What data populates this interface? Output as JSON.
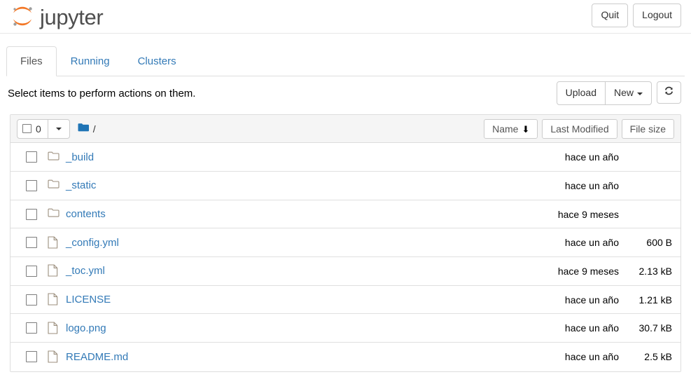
{
  "brand": {
    "name": "jupyter",
    "logo_icon": "jupyter-logo",
    "logo_color": "#f37726"
  },
  "header": {
    "quit_label": "Quit",
    "logout_label": "Logout"
  },
  "tabs": [
    {
      "label": "Files",
      "active": true
    },
    {
      "label": "Running",
      "active": false
    },
    {
      "label": "Clusters",
      "active": false
    }
  ],
  "actionbar": {
    "note": "Select items to perform actions on them.",
    "upload_label": "Upload",
    "new_label": "New",
    "new_caret_icon": "caret-down-icon",
    "refresh_icon": "refresh-icon"
  },
  "filelist": {
    "select_all_count": "0",
    "select_all_checkbox_icon": "checkbox-unchecked-icon",
    "select_caret_icon": "caret-down-icon",
    "breadcrumb_folder_icon": "folder-filled-icon",
    "breadcrumb_path": "/",
    "columns": {
      "name": "Name",
      "name_sort_icon": "arrow-down-icon",
      "last_modified": "Last Modified",
      "file_size": "File size"
    },
    "rows": [
      {
        "icon": "folder-icon",
        "name": "_build",
        "modified": "hace un año",
        "size": ""
      },
      {
        "icon": "folder-icon",
        "name": "_static",
        "modified": "hace un año",
        "size": ""
      },
      {
        "icon": "folder-icon",
        "name": "contents",
        "modified": "hace 9 meses",
        "size": ""
      },
      {
        "icon": "file-icon",
        "name": "_config.yml",
        "modified": "hace un año",
        "size": "600 B"
      },
      {
        "icon": "file-icon",
        "name": "_toc.yml",
        "modified": "hace 9 meses",
        "size": "2.13 kB"
      },
      {
        "icon": "file-icon",
        "name": "LICENSE",
        "modified": "hace un año",
        "size": "1.21 kB"
      },
      {
        "icon": "file-icon",
        "name": "logo.png",
        "modified": "hace un año",
        "size": "30.7 kB"
      },
      {
        "icon": "file-icon",
        "name": "README.md",
        "modified": "hace un año",
        "size": "2.5 kB"
      }
    ]
  },
  "colors": {
    "link": "#337ab7",
    "brand_orange": "#f37726",
    "header_bg": "#f5f5f5",
    "border": "#dddddd"
  }
}
